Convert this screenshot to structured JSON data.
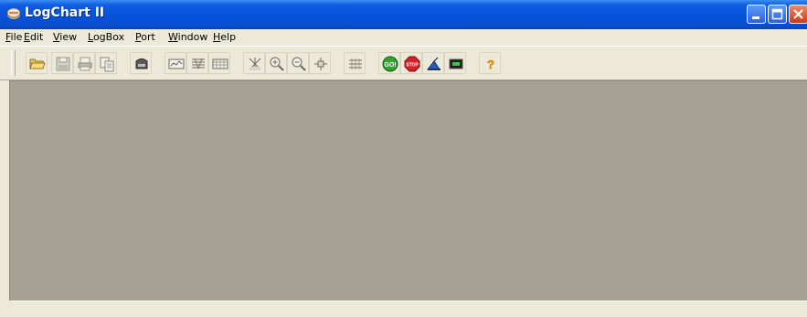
{
  "window": {
    "title": "LogChart II"
  },
  "menu": {
    "items": [
      {
        "label": "File"
      },
      {
        "label": "Edit"
      },
      {
        "label": "View"
      },
      {
        "label": "LogBox"
      },
      {
        "label": "Port"
      },
      {
        "label": "Window"
      },
      {
        "label": "Help"
      }
    ]
  },
  "toolbar": {
    "buttons": [
      {
        "name": "open-folder-icon"
      },
      {
        "name": "save-disk-icon"
      },
      {
        "name": "print-icon"
      },
      {
        "name": "copy-icon"
      },
      {
        "name": "device-icon"
      },
      {
        "name": "chart-view-icon"
      },
      {
        "name": "table-view-icon"
      },
      {
        "name": "grid-view-icon"
      },
      {
        "name": "zoom-full-icon"
      },
      {
        "name": "zoom-in-icon"
      },
      {
        "name": "zoom-out-icon"
      },
      {
        "name": "pan-icon"
      },
      {
        "name": "scale-icon"
      },
      {
        "name": "go-icon",
        "text": "GO!"
      },
      {
        "name": "stop-icon",
        "text": "STOP"
      },
      {
        "name": "settings-icon"
      },
      {
        "name": "monitor-icon"
      },
      {
        "name": "help-icon",
        "text": "?"
      }
    ]
  },
  "colors": {
    "title_bar": "#0352d9",
    "client_area": "#a6a293",
    "face": "#ece9d8",
    "go": "#2fa52a",
    "stop": "#d81f2a",
    "help": "#f5a800"
  }
}
